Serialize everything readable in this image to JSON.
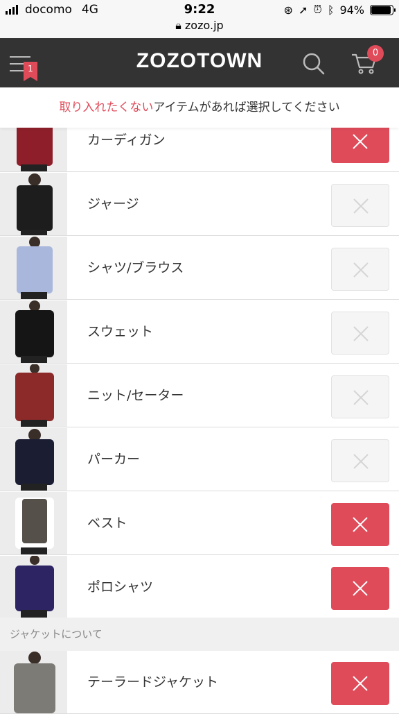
{
  "status_bar": {
    "carrier": "docomo",
    "network": "4G",
    "time": "9:22",
    "url": "zozo.jp",
    "battery": "94%"
  },
  "header": {
    "logo": "ZOZOTOWN",
    "menu_badge": "1",
    "cart_count": "0"
  },
  "banner": {
    "accent_text": "取り入れたくない",
    "rest_text": "アイテムがあれば選択してください"
  },
  "items": [
    {
      "label": "カーディガン",
      "selected": true
    },
    {
      "label": "ジャージ",
      "selected": false
    },
    {
      "label": "シャツ/ブラウス",
      "selected": false
    },
    {
      "label": "スウェット",
      "selected": false
    },
    {
      "label": "ニット/セーター",
      "selected": false
    },
    {
      "label": "パーカー",
      "selected": false
    },
    {
      "label": "ベスト",
      "selected": true
    },
    {
      "label": "ポロシャツ",
      "selected": true
    }
  ],
  "section": {
    "title": "ジャケットについて"
  },
  "section_items": [
    {
      "label": "テーラードジャケット",
      "selected": true
    }
  ],
  "colors": {
    "accent": "#e04b5a",
    "header_bg": "#333333"
  }
}
